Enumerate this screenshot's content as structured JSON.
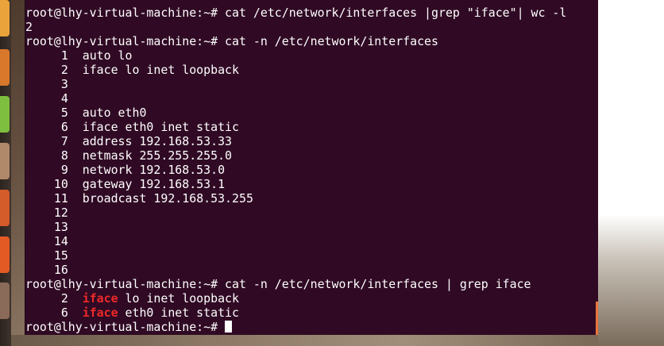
{
  "launcher": {
    "icons": [
      {
        "name": "ubuntu-software-icon",
        "color": "#e9a33a"
      },
      {
        "name": "files-icon",
        "color": "#d9782b"
      },
      {
        "name": "libreoffice-calc-icon",
        "color": "#7fbf3f"
      },
      {
        "name": "app-icon-4",
        "color": "#b0896a"
      },
      {
        "name": "app-icon-5",
        "color": "#d45b2a"
      },
      {
        "name": "app-icon-6",
        "color": "#e45a25"
      },
      {
        "name": "app-icon-7",
        "color": "#8a6a58"
      }
    ]
  },
  "terminal": {
    "background": "#300a24",
    "highlight_color": "#ef2929",
    "lines": [
      {
        "prompt": "root@lhy-virtual-machine:~# ",
        "command": "cat /etc/network/interfaces |grep \"iface\"| wc -l"
      },
      {
        "text": "2"
      },
      {
        "prompt": "root@lhy-virtual-machine:~# ",
        "command": "cat -n /etc/network/interfaces"
      },
      {
        "num": "1",
        "text": "auto lo"
      },
      {
        "num": "2",
        "text": "iface lo inet loopback"
      },
      {
        "num": "3",
        "text": ""
      },
      {
        "num": "4",
        "text": ""
      },
      {
        "num": "5",
        "text": "auto eth0"
      },
      {
        "num": "6",
        "text": "iface eth0 inet static"
      },
      {
        "num": "7",
        "text": "address 192.168.53.33"
      },
      {
        "num": "8",
        "text": "netmask 255.255.255.0"
      },
      {
        "num": "9",
        "text": "network 192.168.53.0"
      },
      {
        "num": "10",
        "text": "gateway 192.168.53.1"
      },
      {
        "num": "11",
        "text": "broadcast 192.168.53.255"
      },
      {
        "num": "12",
        "text": ""
      },
      {
        "num": "13",
        "text": ""
      },
      {
        "num": "14",
        "text": ""
      },
      {
        "num": "15",
        "text": ""
      },
      {
        "num": "16",
        "text": ""
      },
      {
        "prompt": "root@lhy-virtual-machine:~# ",
        "command": "cat -n /etc/network/interfaces | grep iface"
      },
      {
        "num": "2",
        "match": "iface",
        "text": " lo inet loopback"
      },
      {
        "num": "6",
        "match": "iface",
        "text": " eth0 inet static"
      },
      {
        "prompt": "root@lhy-virtual-machine:~# ",
        "command": "",
        "cursor": true
      }
    ]
  }
}
